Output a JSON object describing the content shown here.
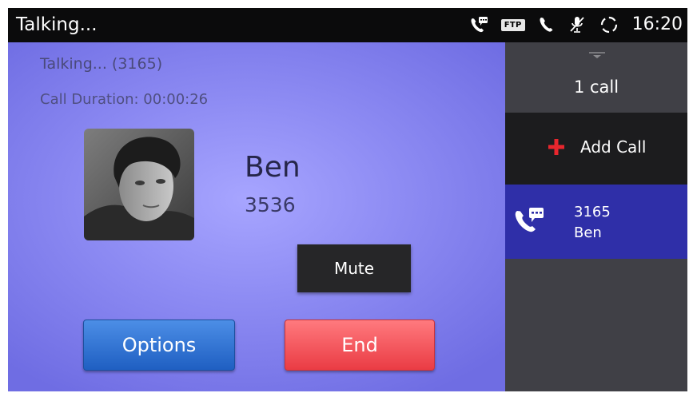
{
  "status_bar": {
    "title": "Talking...",
    "ftp_badge": "FTP",
    "time": "16:20"
  },
  "call_panel": {
    "status": "Talking... (3165)",
    "duration": "Call Duration: 00:00:26",
    "contact_name": "Ben",
    "contact_number": "3536",
    "mute_label": "Mute",
    "options_label": "Options",
    "end_label": "End"
  },
  "sidebar": {
    "call_count": "1 call",
    "add_call_label": "Add Call",
    "calls": [
      {
        "number": "3165",
        "name": "Ben"
      }
    ]
  },
  "colors": {
    "panel_background": "#8d8bf3",
    "active_call_background": "#2f2fa8",
    "end_button": "#ea3c44",
    "options_button": "#1f5fc2",
    "add_icon": "#e8262d"
  },
  "icons": [
    "call-message-icon",
    "ftp-icon",
    "phone-icon",
    "mic-muted-icon",
    "sync-icon",
    "drag-handle-icon",
    "plus-icon"
  ]
}
